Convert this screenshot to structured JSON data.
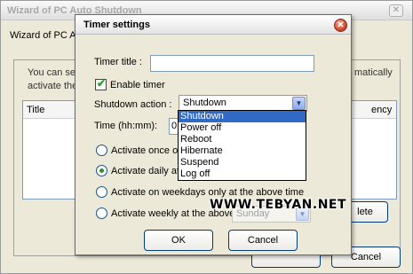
{
  "background_window": {
    "title": "Wizard of PC Auto Shutdown",
    "header_text": "Wizard of PC Au",
    "description_line1": "You can se",
    "description_line2": "activate the",
    "description_right1": "matically",
    "list_columns": [
      "Title",
      "ency"
    ],
    "buttons": {
      "delete_label": "lete",
      "cancel_label": "Cancel"
    }
  },
  "dialog": {
    "title": "Timer settings",
    "timer_title_label": "Timer title :",
    "timer_title_value": "",
    "enable_timer_label": "Enable timer",
    "enable_timer_checked": true,
    "shutdown_action_label": "Shutdown action :",
    "shutdown_action_value": "Shutdown",
    "shutdown_action_options": [
      "Shutdown",
      "Power off",
      "Reboot",
      "Hibernate",
      "Suspend",
      "Log off"
    ],
    "time_label": "Time (hh:mm):",
    "time_value": "0",
    "radio_options": [
      {
        "label": "Activate once o",
        "selected": false
      },
      {
        "label": "Activate daily at",
        "selected": true
      },
      {
        "label": "Activate on weekdays only at the above time",
        "selected": false
      },
      {
        "label": "Activate weekly at the above time",
        "selected": false
      }
    ],
    "weekday_select_value": "Sunday",
    "ok_label": "OK",
    "cancel_label": "Cancel"
  },
  "watermark": "WWW.TEBYAN.NET",
  "colors": {
    "selection": "#316ac5",
    "checkmark": "#21a121",
    "close_button": "#d04a30",
    "window_face": "#ece9d8"
  }
}
